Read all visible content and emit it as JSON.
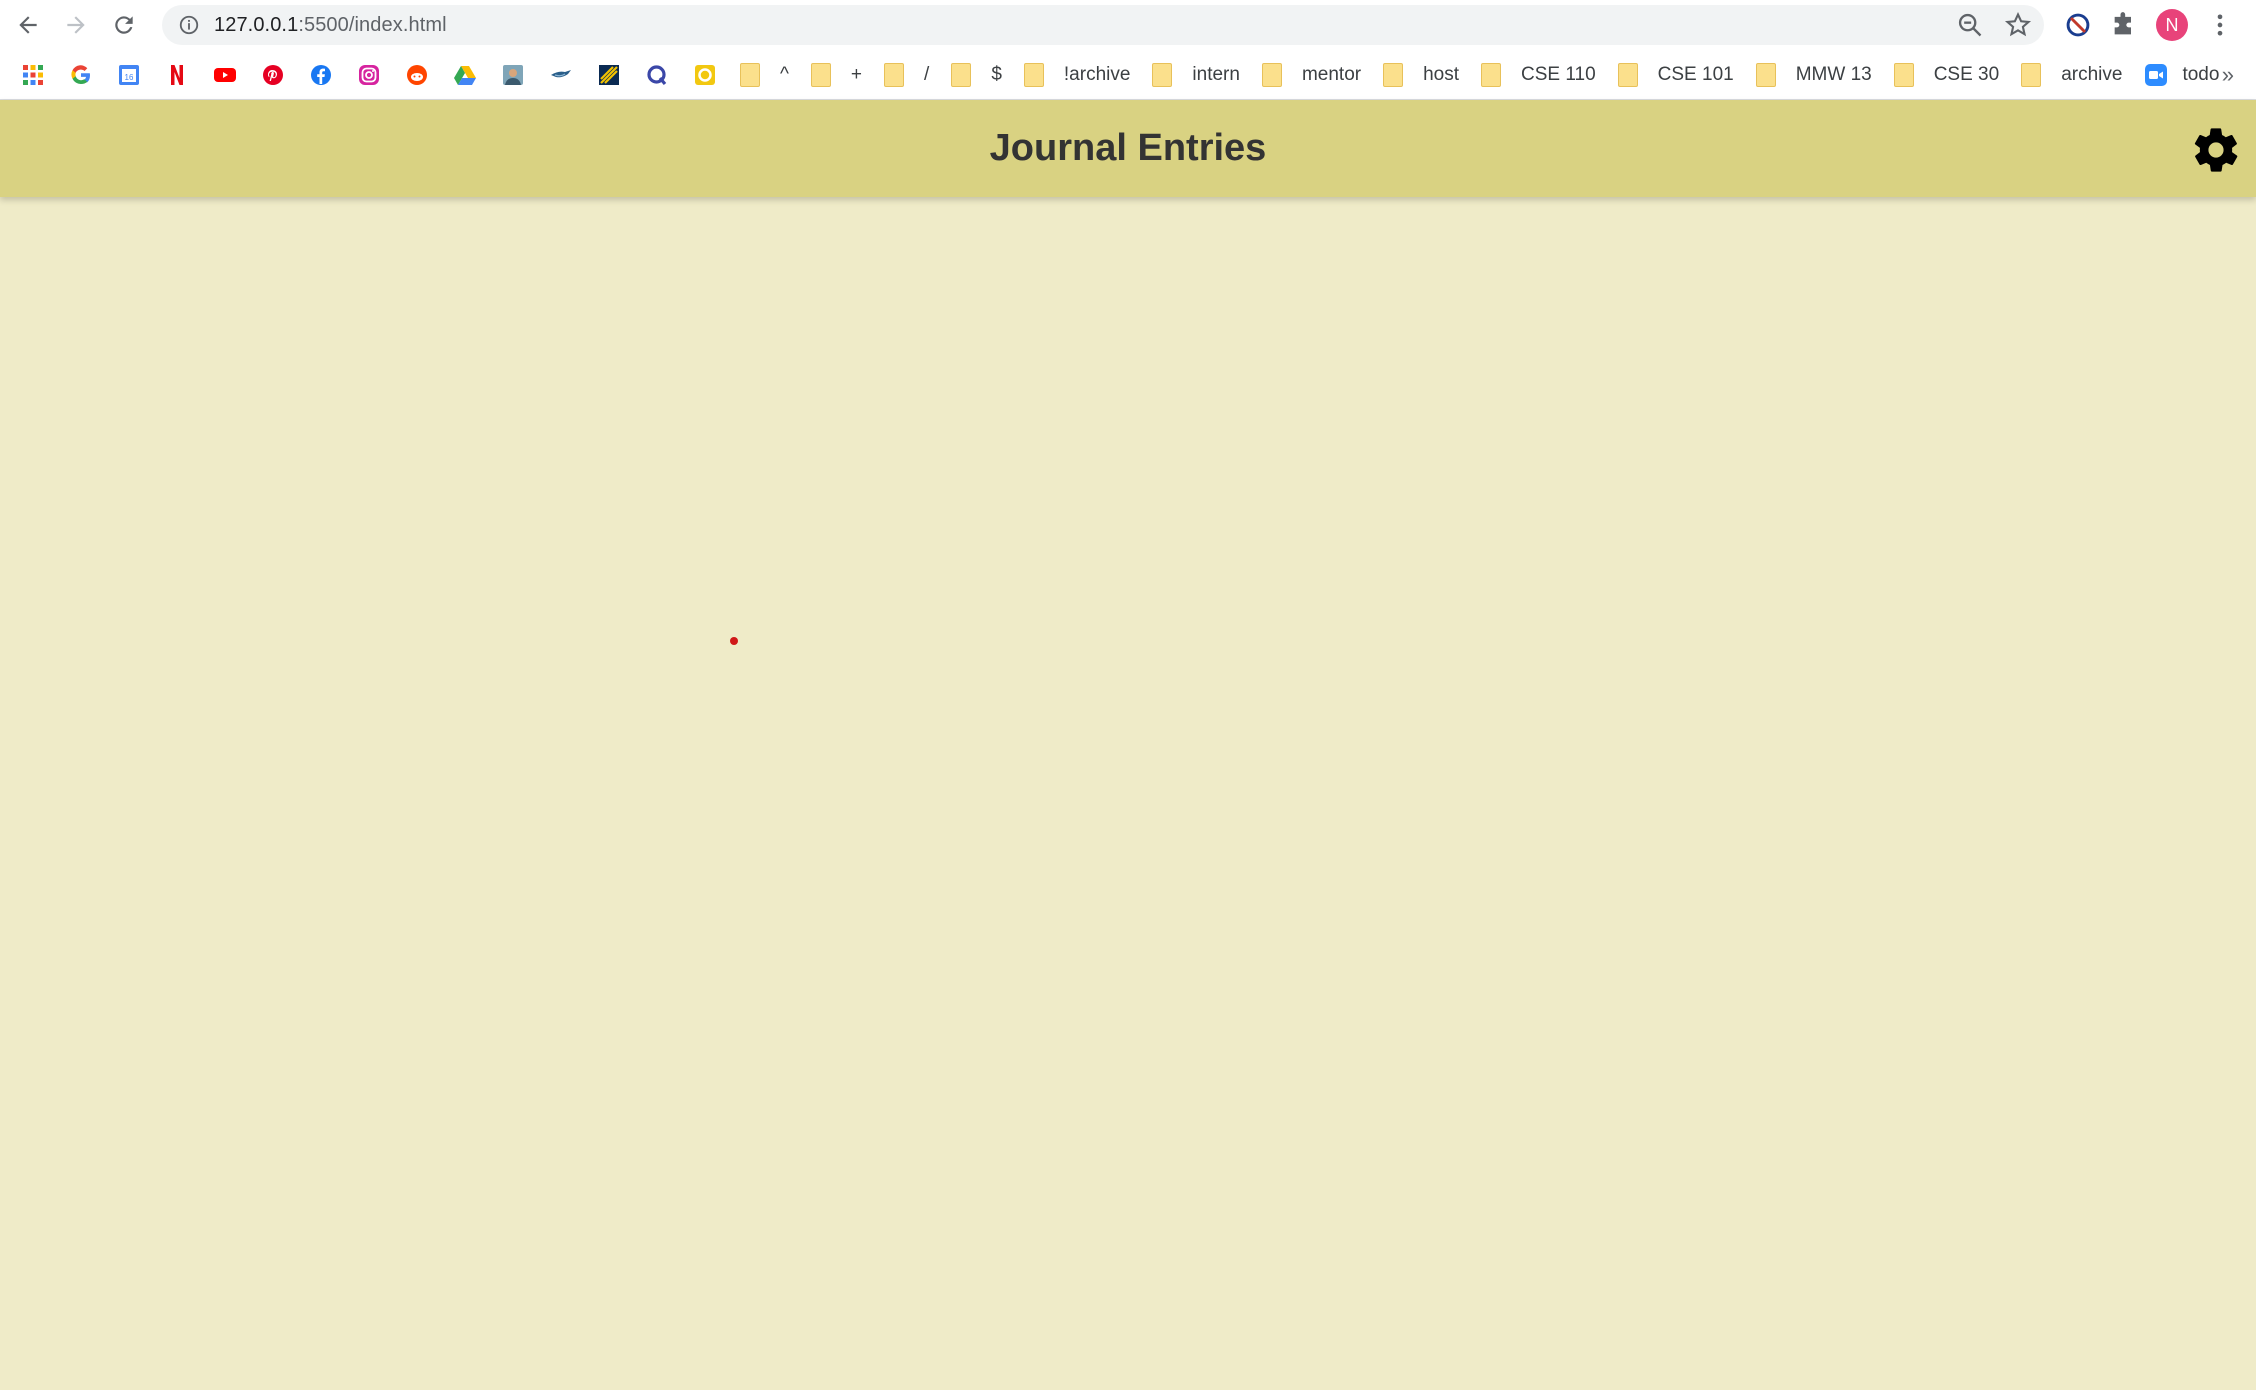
{
  "browser": {
    "url_host": "127.0.0.1",
    "url_path": ":5500/index.html",
    "profile_initial": "N",
    "nav_icons": [
      "back-icon",
      "forward-icon",
      "reload-icon"
    ],
    "omnibox_icons": [
      "site-info-icon",
      "zoom-icon",
      "bookmark-star-icon"
    ],
    "extension_icons": [
      "blocked-extension-icon",
      "puzzle-extensions-icon",
      "kebab-menu-icon"
    ]
  },
  "bookmarks": {
    "icon_items": [
      "apps-grid-icon",
      "google-icon",
      "calendar-icon",
      "netflix-icon",
      "youtube-icon",
      "pinterest-icon",
      "facebook-icon",
      "instagram-icon",
      "reddit-icon",
      "drive-icon",
      "photo-icon",
      "bird-icon",
      "stripes-icon",
      "q-icon",
      "circle-icon"
    ],
    "folders": [
      "^",
      "+",
      "/",
      "$",
      "!archive",
      "intern",
      "mentor",
      "host",
      "CSE 110",
      "CSE 101",
      "MMW 13",
      "CSE 30",
      "archive"
    ],
    "last_item": "todo",
    "overflow": "»"
  },
  "page": {
    "title": "Journal Entries",
    "colors": {
      "background": "#efebc8",
      "header": "#d9d282",
      "title_text": "#333333"
    }
  }
}
